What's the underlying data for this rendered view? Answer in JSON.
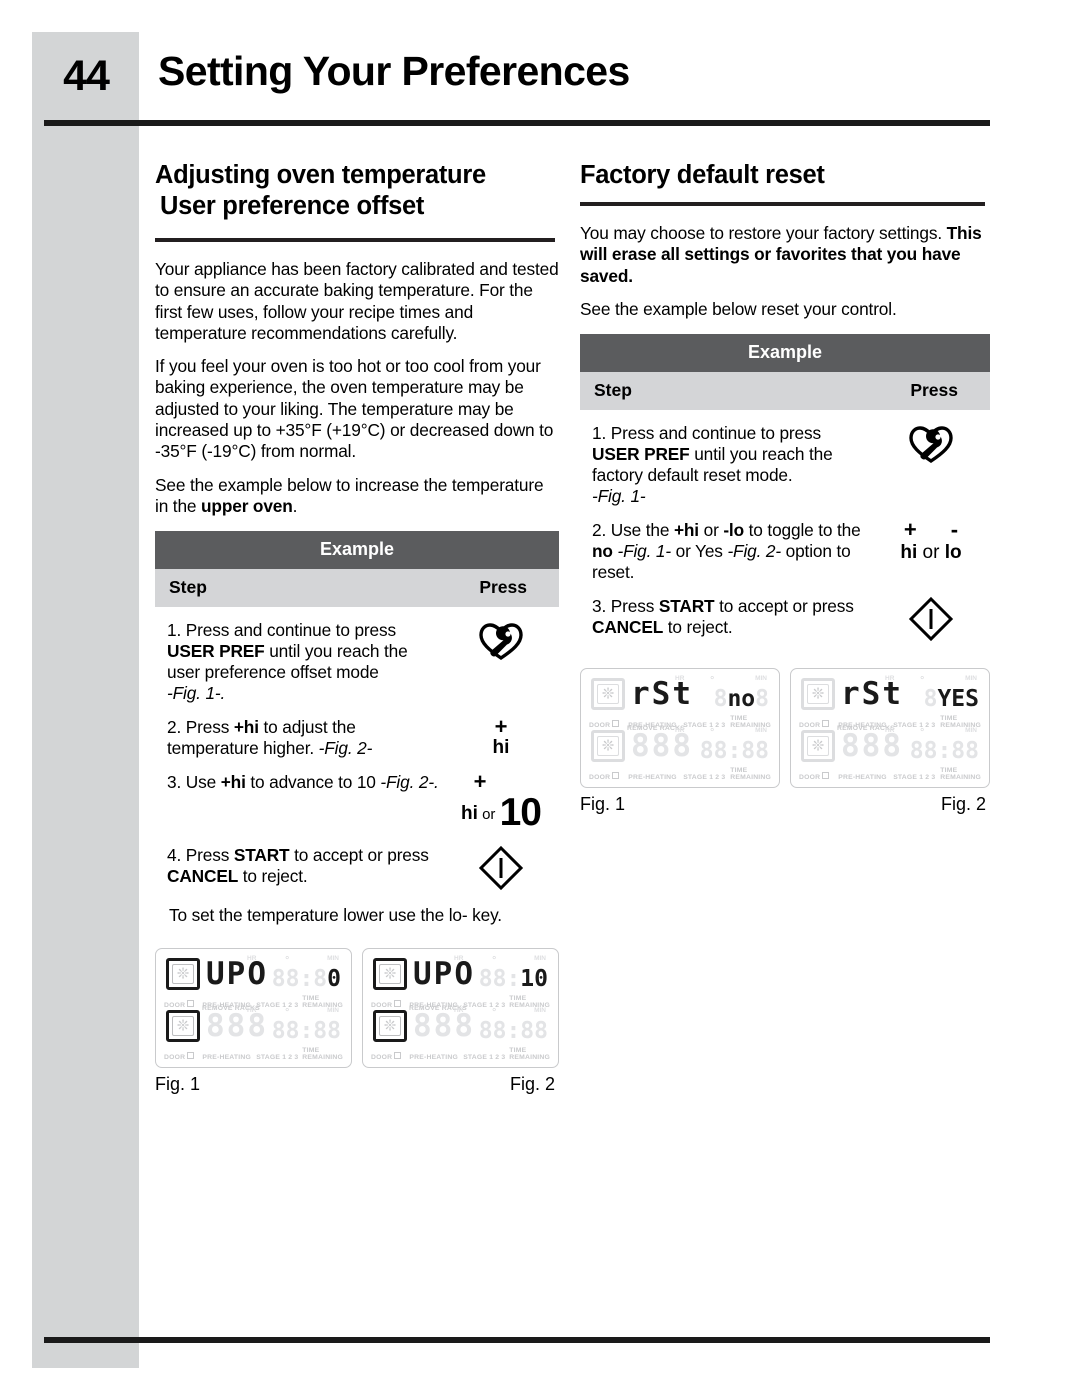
{
  "page": {
    "number": "44",
    "title": "Setting Your Preferences"
  },
  "left_column": {
    "heading_line1": "Adjusting oven temperature",
    "heading_line2": "User preference offset",
    "paragraphs": [
      "Your appliance has been factory calibrated and tested to ensure an accurate baking temperature. For the first few uses, follow your recipe times and temperature recommendations carefully.",
      "If you feel your oven is too hot or too cool from your baking experience, the oven temperature may be adjusted to your liking. The temperature may be increased  up to +35°F (+19°C) or decreased down to -35°F (-19°C) from normal."
    ],
    "see_example_pre": "See the example below to increase the temperature in the ",
    "see_example_bold": "upper oven",
    "see_example_post": ".",
    "table": {
      "title": "Example",
      "col_step": "Step",
      "col_press": "Press",
      "steps": [
        {
          "number": "1.",
          "text_parts": [
            "Press and continue to press ",
            "USER PREF",
            " until you reach the user preference offset mode"
          ],
          "fig_ref": "-Fig. 1-.",
          "press_icon": "user-pref-wrench-heart-icon"
        },
        {
          "number": "2.",
          "text_parts": [
            "Press ",
            "+hi",
            " to adjust the temperature higher. "
          ],
          "fig_ref": "-Fig. 2-",
          "press_plus": "+",
          "press_hi": "hi"
        },
        {
          "number": "3.",
          "text_parts": [
            "Use ",
            "+hi",
            " to advance to 10 "
          ],
          "fig_ref": "-Fig. 2-.",
          "press_plus": "+",
          "press_hi": "hi",
          "press_or": " or ",
          "press_value": "10"
        },
        {
          "number": "4.",
          "text_parts": [
            "Press ",
            "START",
            " to accept or press ",
            "CANCEL",
            " to reject."
          ],
          "press_icon": "start-diamond-icon"
        }
      ]
    },
    "note": "To set the temperature lower use the lo- key.",
    "figures": [
      {
        "caption": "Fig. 1",
        "display_main": "UPO",
        "display_clock_ghost": "88:8",
        "display_clock_on": "0"
      },
      {
        "caption": "Fig. 2",
        "display_main": "UPO",
        "display_clock_ghost": "88:",
        "display_clock_on": "10"
      }
    ]
  },
  "right_column": {
    "heading": "Factory default reset",
    "intro_normal": "You may choose to restore your factory settings. ",
    "intro_bold": "This will erase all settings or favorites that you have saved.",
    "see_example": "See the example below reset your control.",
    "table": {
      "title": "Example",
      "col_step": "Step",
      "col_press": "Press",
      "steps": [
        {
          "number": "1.",
          "text_parts": [
            "Press and continue to press ",
            "USER PREF",
            " until you reach the factory default reset mode."
          ],
          "fig_ref": "-Fig. 1-",
          "press_icon": "user-pref-wrench-heart-icon"
        },
        {
          "number": "2.",
          "text_parts": [
            "Use the ",
            "+hi",
            " or ",
            "-lo",
            " to toggle to the ",
            "no",
            " "
          ],
          "fig_ref_a": "-Fig. 1-",
          "text_mid": " or Yes ",
          "fig_ref_b": "-Fig. 2-",
          "text_end": " option to reset.",
          "press_plus": "+",
          "press_minus": "-",
          "press_hi": "hi",
          "press_or": " or ",
          "press_lo": "lo"
        },
        {
          "number": "3.",
          "text_parts": [
            "Press ",
            "START",
            " to accept or press ",
            "CANCEL",
            " to reject."
          ],
          "press_icon": "start-diamond-icon"
        }
      ]
    },
    "figures": [
      {
        "caption": "Fig. 1",
        "display_main": "rSt",
        "display_clock_ghost_left": "8",
        "display_clock_on": "no",
        "display_clock_ghost_right": "8"
      },
      {
        "caption": "Fig. 2",
        "display_main": "rSt",
        "display_clock_ghost_left": "8",
        "display_clock_on": "YES"
      }
    ]
  },
  "lcd_labels": {
    "door": "DOOR",
    "preheating": "PRE-HEATING",
    "stage": "STAGE 1 2 3",
    "time_remaining": "TIME REMAINING",
    "remove_racks": "REMOVE RACKS",
    "hr": "HR",
    "min": "MIN",
    "ghost_main": "888",
    "ghost_clock": "88:88"
  },
  "colors": {
    "band_gray": "#d3d5d6",
    "table_header_dark": "#5b5c5e",
    "table_subhead_gray": "#d4d5d7",
    "rule_black": "#1a1a1a",
    "lcd_ghost": "#e3e4e6"
  }
}
